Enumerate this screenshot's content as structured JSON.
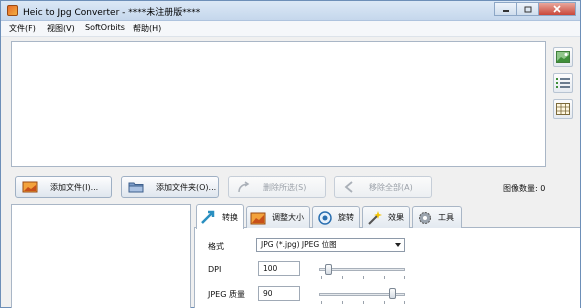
{
  "window": {
    "title": "Heic to Jpg Converter - ****未注册版****",
    "controls": [
      "minimize",
      "maximize",
      "close"
    ]
  },
  "menu": {
    "items": [
      {
        "label": "文件(F)"
      },
      {
        "label": "视图(V)"
      },
      {
        "label": "SoftOrbits"
      },
      {
        "label": "帮助(H)"
      }
    ]
  },
  "view_buttons": [
    "thumbnails-view-icon",
    "list-view-icon",
    "table-view-icon"
  ],
  "toolbar": {
    "add_files": "添加文件(I)...",
    "add_folder": "添加文件夹(O)...",
    "remove_selected": "删除所选(S)",
    "remove_all": "移除全部(A)",
    "image_count_label": "图像数量: 0"
  },
  "tabs": [
    {
      "label": "转换",
      "icon": "convert-icon",
      "active": true
    },
    {
      "label": "调整大小",
      "icon": "resize-icon",
      "active": false
    },
    {
      "label": "旋转",
      "icon": "rotate-icon",
      "active": false
    },
    {
      "label": "效果",
      "icon": "effects-wand-icon",
      "active": false
    },
    {
      "label": "工具",
      "icon": "tools-gear-icon",
      "active": false
    }
  ],
  "convert": {
    "format_label": "格式",
    "format_value": "JPG (*.jpg) JPEG 位图",
    "dpi_label": "DPI",
    "dpi_value": "100",
    "quality_label": "JPEG 质量",
    "quality_value": "90"
  },
  "colors": {
    "titlebar": "#c5d7ec",
    "accent_orange": "#e86a2a",
    "border": "#a9b6c6"
  }
}
